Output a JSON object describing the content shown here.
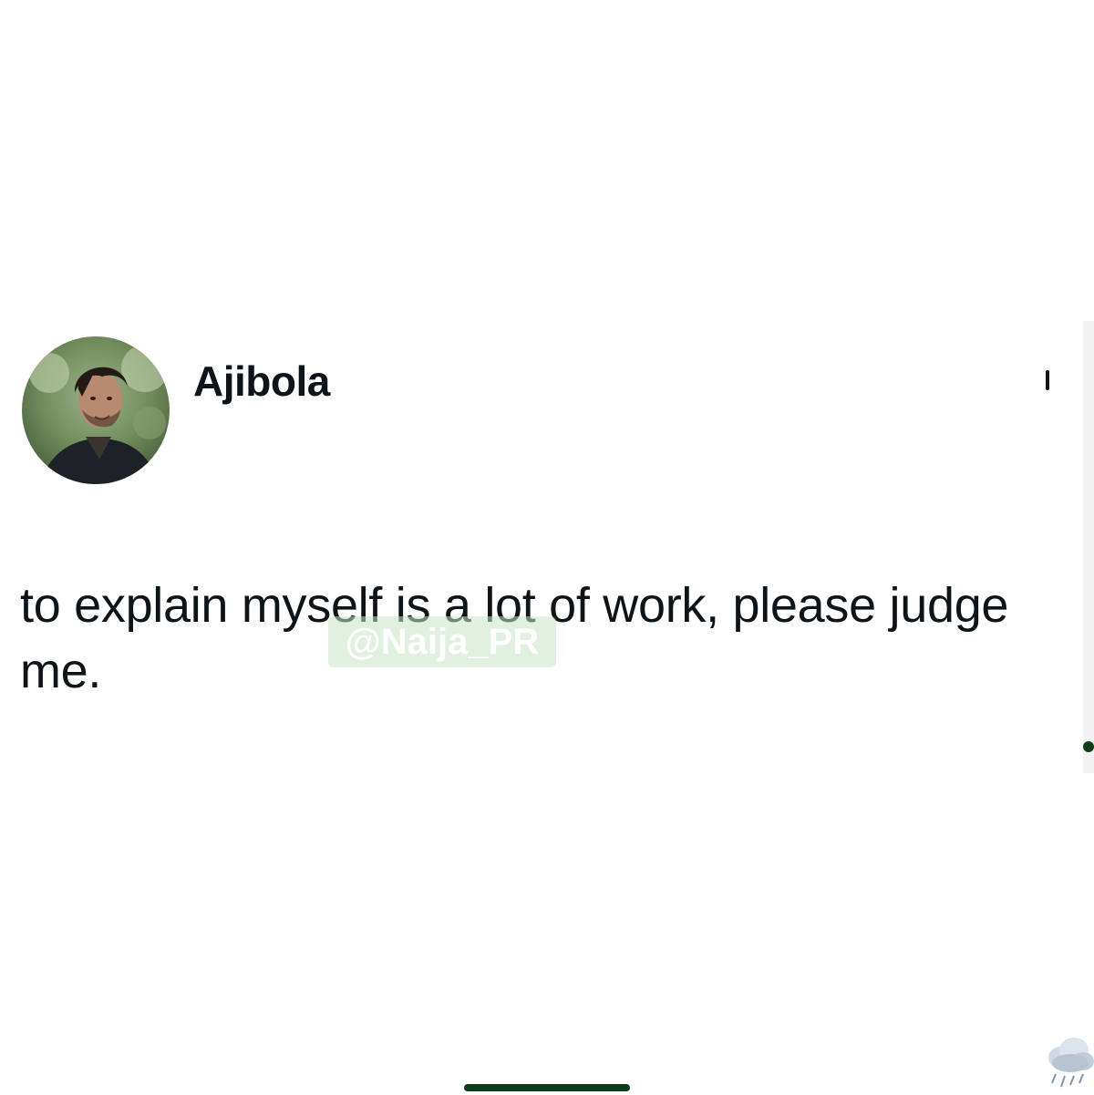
{
  "tweet": {
    "display_name": "Ajibola",
    "text": "to explain myself is a lot of work, please judge me."
  },
  "watermark": {
    "text": "@Naija_PR"
  },
  "colors": {
    "text": "#0f1419",
    "background": "#ffffff",
    "watermark_bg": "#c8e4c8",
    "home_indicator": "#0f3d1c"
  },
  "icons": {
    "avatar": "profile-photo",
    "corner": "storm-cloud-emoji"
  }
}
